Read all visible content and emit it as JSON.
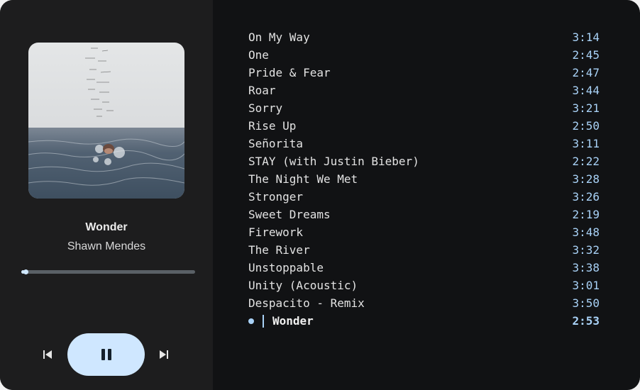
{
  "player": {
    "title": "Wonder",
    "artist": "Shawn Mendes",
    "progress_fraction": 0.02,
    "accent": "#cfe7ff",
    "controls": {
      "prev_icon": "skip-previous-icon",
      "play_icon": "pause-icon",
      "next_icon": "skip-next-icon"
    }
  },
  "playlist": {
    "current_index": 16,
    "tracks": [
      {
        "title": "On My Way",
        "duration": "3:14"
      },
      {
        "title": "One",
        "duration": "2:45"
      },
      {
        "title": "Pride & Fear",
        "duration": "2:47"
      },
      {
        "title": "Roar",
        "duration": "3:44"
      },
      {
        "title": "Sorry",
        "duration": "3:21"
      },
      {
        "title": "Rise Up",
        "duration": "2:50"
      },
      {
        "title": "Señorita",
        "duration": "3:11"
      },
      {
        "title": "STAY (with Justin Bieber)",
        "duration": "2:22"
      },
      {
        "title": "The Night We Met",
        "duration": "3:28"
      },
      {
        "title": "Stronger",
        "duration": "3:26"
      },
      {
        "title": "Sweet Dreams",
        "duration": "2:19"
      },
      {
        "title": "Firework",
        "duration": "3:48"
      },
      {
        "title": "The River",
        "duration": "3:32"
      },
      {
        "title": "Unstoppable",
        "duration": "3:38"
      },
      {
        "title": "Unity (Acoustic)",
        "duration": "3:01"
      },
      {
        "title": "Despacito - Remix",
        "duration": "3:50"
      },
      {
        "title": "Wonder",
        "duration": "2:53"
      }
    ]
  }
}
